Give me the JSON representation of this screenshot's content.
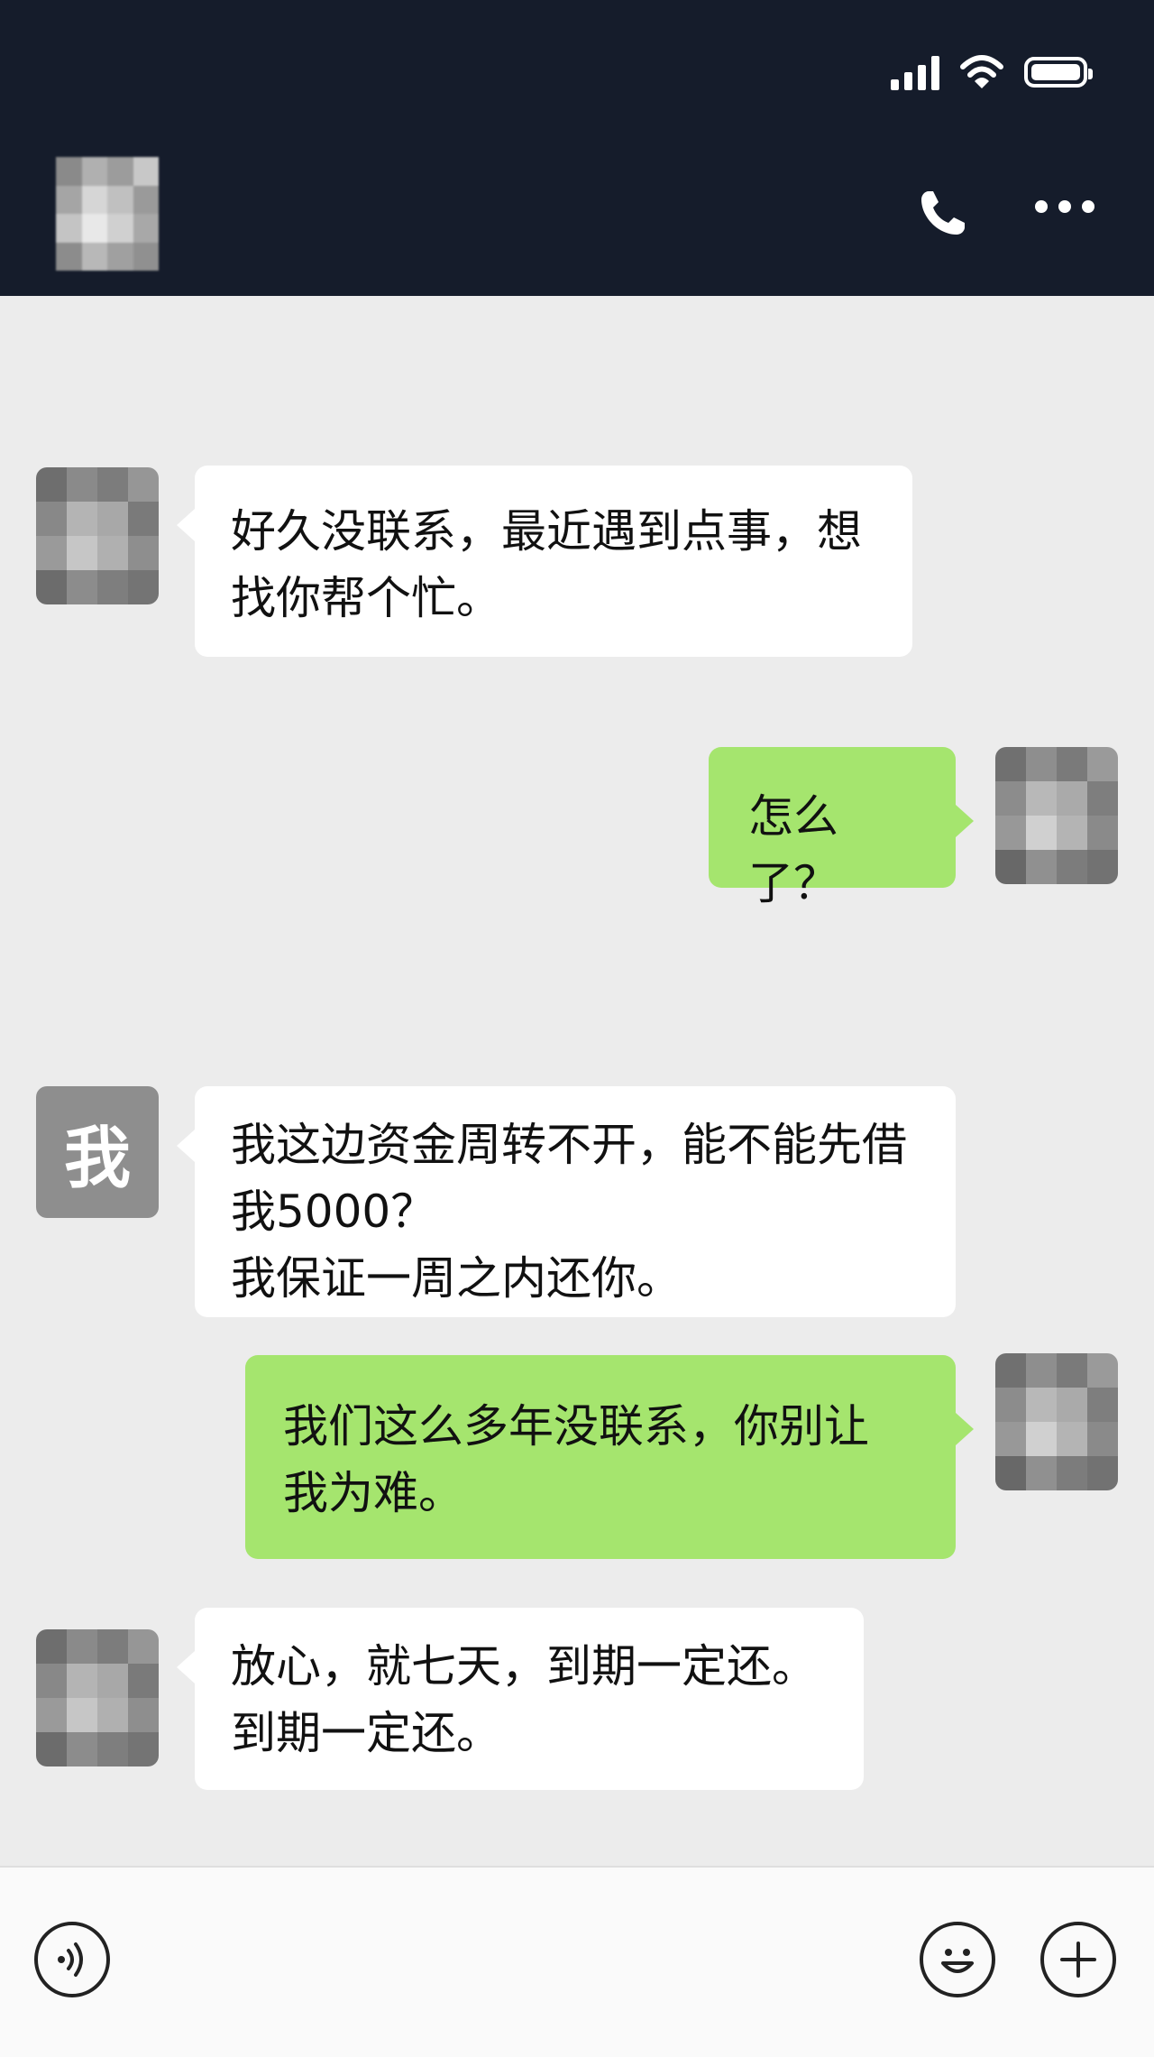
{
  "header": {
    "contact_name": "",
    "status_icons": [
      "signal-icon",
      "wifi-icon",
      "battery-icon"
    ],
    "actions": [
      "phone-icon",
      "more-icon"
    ]
  },
  "messages": [
    {
      "side": "left",
      "avatar": "mosaic",
      "text": "好久没联系，最近遇到点事，想\n找你帮个忙。"
    },
    {
      "side": "right",
      "avatar": "mosaic",
      "text": "怎么了？"
    },
    {
      "side": "left",
      "avatar": "text",
      "avatar_text": "我",
      "text": "我这边资金周转不开，能不能先借\n我5000？\n我保证一周之内还你。"
    },
    {
      "side": "right",
      "avatar": "mosaic",
      "text": "我们这么多年没联系，你别让\n我为难。"
    },
    {
      "side": "left",
      "avatar": "mosaic",
      "text": "放心，就七天，到期一定还。\n到期一定还。"
    }
  ],
  "input_bar": {
    "left_icon": "voice-icon",
    "right_icons": [
      "emoji-icon",
      "plus-icon"
    ]
  },
  "colors": {
    "header_bg": "#151c2b",
    "chat_bg": "#ececec",
    "bubble_left": "#ffffff",
    "bubble_right": "#a5e56e"
  }
}
